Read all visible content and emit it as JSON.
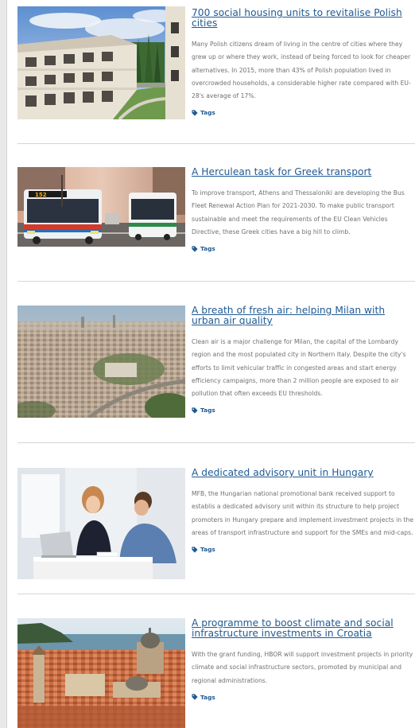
{
  "articles": [
    {
      "title": "700 social housing units to revitalise Polish cities",
      "summary": "Many Polish citizens dream of living in the centre of cities where they grew up or where they work, instead of being forced to look for cheaper alternatives. In 2015, more than 43% of Polish population lived in overcrowded households, a considerable higher rate compared with EU-28's average of 17%.",
      "tags_label": "Tags"
    },
    {
      "title": "A Herculean task for Greek transport",
      "summary": "To improve transport, Athens and Thessaloniki are developing the Bus Fleet Renewal Action Plan for 2021-2030. To make public transport sustainable and meet the requirements of the EU Clean Vehicles Directive, these Greek cities have a big hill to climb.",
      "tags_label": "Tags",
      "bus_sign": "152"
    },
    {
      "title": "A breath of fresh air: helping Milan with urban air quality",
      "summary": "Clean air is a major challenge for Milan, the capital of the Lombardy region and the most populated city in Northern Italy. Despite the city's efforts to limit vehicular traffic in congested areas and start energy efficiency campaigns, more than 2 million people are exposed to air pollution that often exceeds EU thresholds.",
      "tags_label": "Tags"
    },
    {
      "title": "A dedicated advisory unit in Hungary",
      "summary": "MFB, the Hungarian national promotional bank received support to establis a dedicated advisory unit within its structure to help project promoters in Hungary prepare and implement investment projects in the areas of transport infrastructure and support for the SMEs and mid-caps.",
      "tags_label": "Tags"
    },
    {
      "title": "A programme to boost climate and social infrastructure investments in Croatia",
      "summary": "With the grant funding, HBOR will support investment projects in priority climate and social infrastructure sectors, promoted by municipal and regional administrations.",
      "tags_label": "Tags"
    }
  ],
  "colors": {
    "link": "#1f5a93",
    "body_text": "#707070",
    "divider": "#d6d6d6"
  }
}
